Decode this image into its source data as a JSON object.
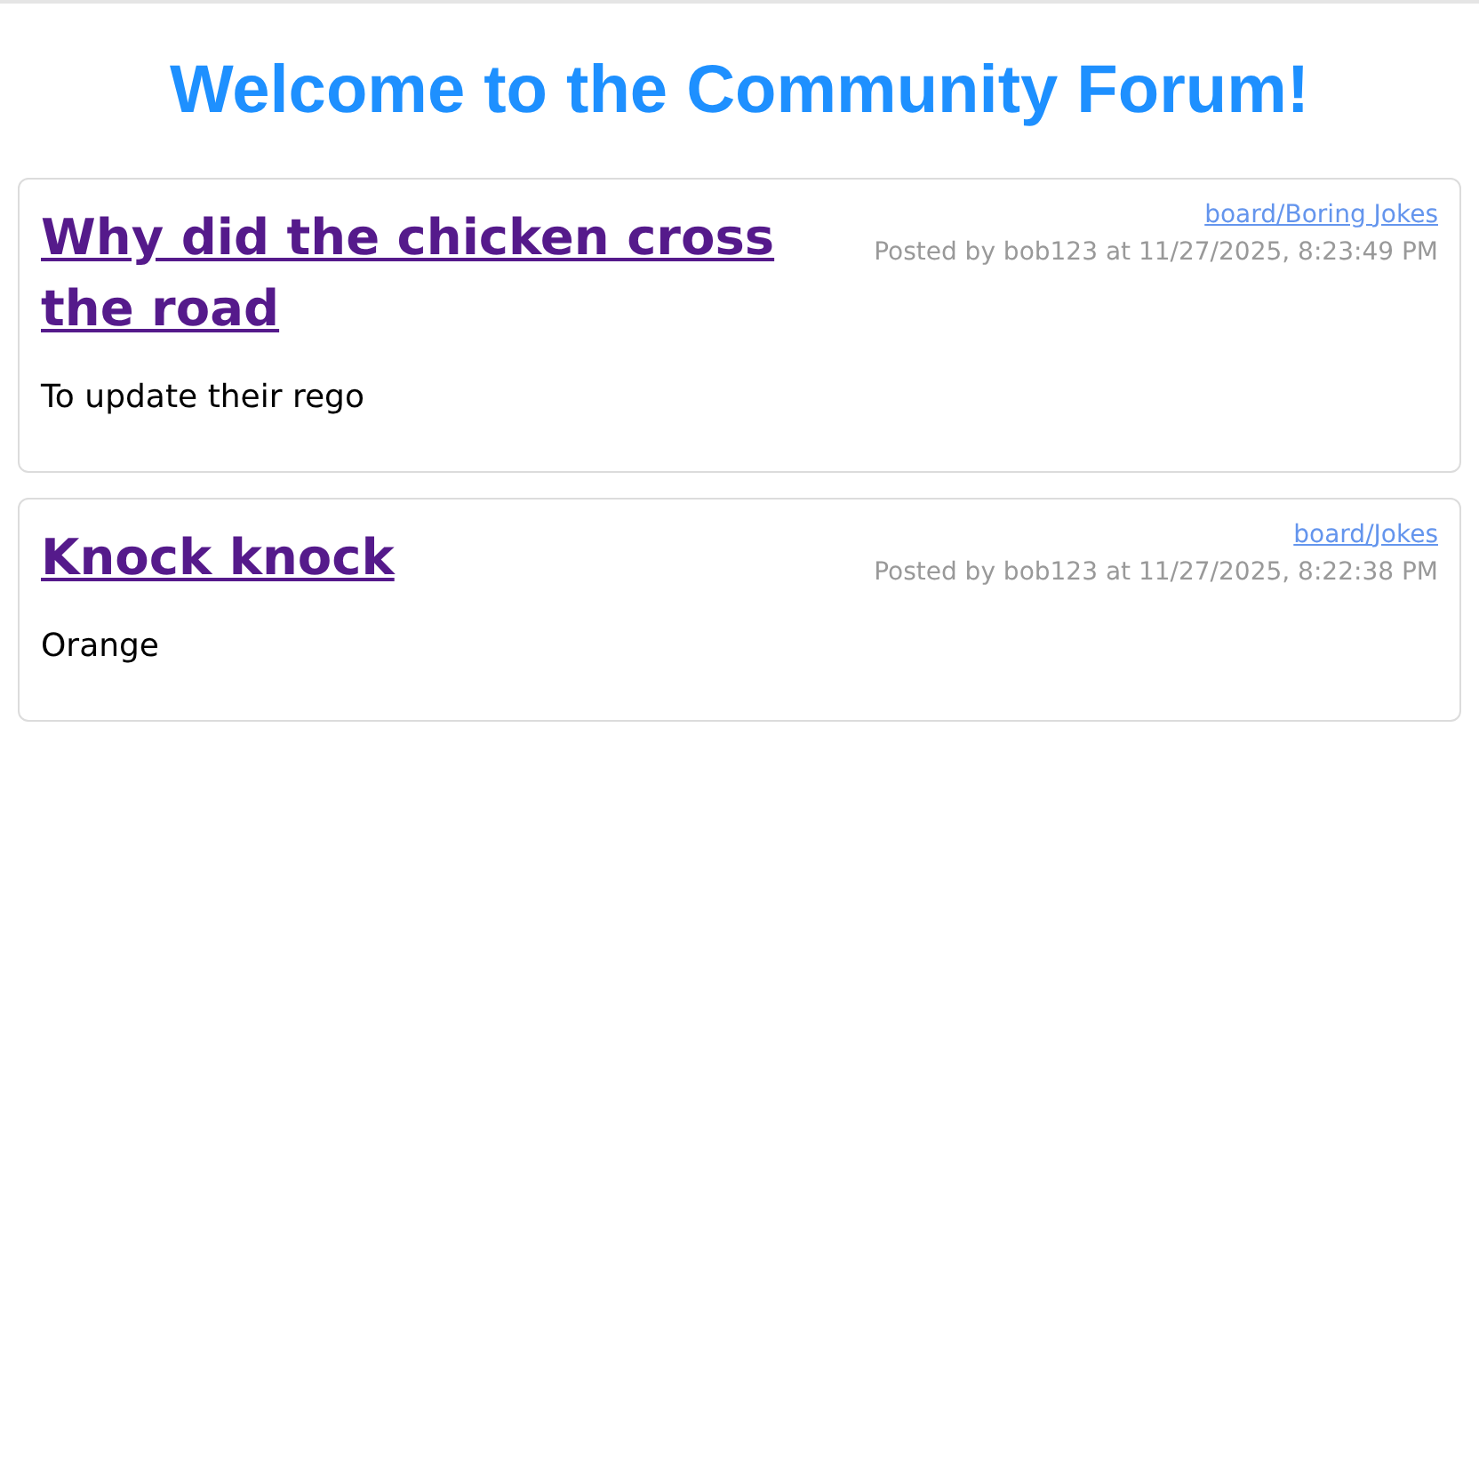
{
  "heading": "Welcome to the Community Forum!",
  "posts": [
    {
      "title": "Why did the chicken cross the road",
      "board": "board/Boring Jokes",
      "meta": "Posted by bob123 at 11/27/2025, 8:23:49 PM",
      "body": "To update their rego"
    },
    {
      "title": "Knock knock",
      "board": "board/Jokes",
      "meta": "Posted by bob123 at 11/27/2025, 8:22:38 PM",
      "body": "Orange"
    }
  ]
}
